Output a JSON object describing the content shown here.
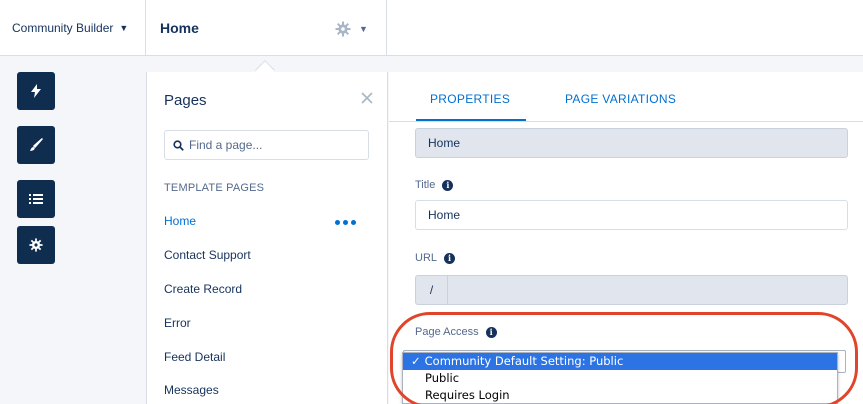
{
  "topbar": {
    "builder_menu_label": "Community Builder",
    "page_menu_label": "Home",
    "page_settings_icon": "gear-icon",
    "caret_glyph": "▼"
  },
  "toolbar": {
    "items": [
      {
        "icon": "lightning-icon"
      },
      {
        "icon": "brush-icon"
      },
      {
        "icon": "list-icon"
      },
      {
        "icon": "gear-icon"
      }
    ]
  },
  "pages_panel": {
    "title": "Pages",
    "search_placeholder": "Find a page...",
    "section_label": "TEMPLATE PAGES",
    "items": [
      {
        "label": "Home",
        "active": true
      },
      {
        "label": "Contact Support"
      },
      {
        "label": "Create Record"
      },
      {
        "label": "Error"
      },
      {
        "label": "Feed Detail"
      },
      {
        "label": "Messages"
      }
    ]
  },
  "properties_panel": {
    "tabs": [
      {
        "label": "PROPERTIES",
        "active": true
      },
      {
        "label": "PAGE VARIATIONS"
      }
    ],
    "name_value": "Home",
    "title_label": "Title",
    "title_value": "Home",
    "url_label": "URL",
    "url_prefix": "/",
    "url_value": "",
    "page_access_label": "Page Access",
    "page_access_options": [
      {
        "label": "Community Default Setting: Public",
        "selected": true
      },
      {
        "label": "Public"
      },
      {
        "label": "Requires Login"
      }
    ],
    "selected_check": "✓"
  },
  "colors": {
    "brand_blue": "#0070d2",
    "dark_navy": "#0f2e4f",
    "highlight_red": "#e0452b",
    "selected_option_bg": "#2c74e4"
  }
}
